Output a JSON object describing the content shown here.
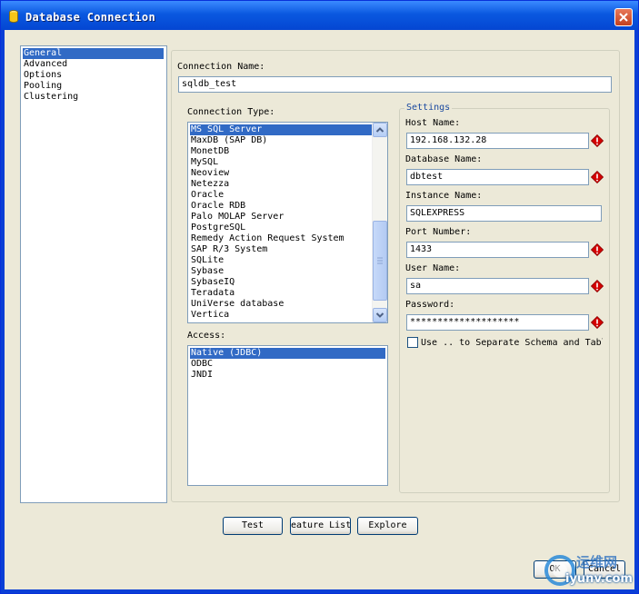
{
  "window": {
    "title": "Database Connection"
  },
  "nav": {
    "items": [
      {
        "label": "General",
        "selected": true
      },
      {
        "label": "Advanced",
        "selected": false
      },
      {
        "label": "Options",
        "selected": false
      },
      {
        "label": "Pooling",
        "selected": false
      },
      {
        "label": "Clustering",
        "selected": false
      }
    ]
  },
  "form": {
    "connection_name_label": "Connection Name:",
    "connection_name_value": "sqldb_test",
    "connection_type_label": "Connection Type:",
    "connection_types": [
      "MS SQL Server",
      "MaxDB (SAP DB)",
      "MonetDB",
      "MySQL",
      "Neoview",
      "Netezza",
      "Oracle",
      "Oracle RDB",
      "Palo MOLAP Server",
      "PostgreSQL",
      "Remedy Action Request System",
      "SAP R/3 System",
      "SQLite",
      "Sybase",
      "SybaseIQ",
      "Teradata",
      "UniVerse database",
      "Vertica"
    ],
    "selected_connection_type": "MS SQL Server",
    "access_label": "Access:",
    "access_options": [
      "Native (JDBC)",
      "ODBC",
      "JNDI"
    ],
    "selected_access": "Native (JDBC)"
  },
  "settings": {
    "title": "Settings",
    "host_name_label": "Host Name:",
    "host_name_value": "192.168.132.28",
    "database_name_label": "Database Name:",
    "database_name_value": "dbtest",
    "instance_name_label": "Instance Name:",
    "instance_name_value": "SQLEXPRESS",
    "port_number_label": "Port Number:",
    "port_number_value": "1433",
    "user_name_label": "User Name:",
    "user_name_value": "sa",
    "password_label": "Password:",
    "password_value": "********************",
    "separate_schema_label": "Use .. to Separate Schema and Tabl",
    "separate_schema_checked": false
  },
  "buttons": {
    "test": "Test",
    "feature_list": "eature List",
    "explore": "Explore",
    "ok": "OK",
    "cancel": "Cancel"
  },
  "watermark": {
    "text": "运维网",
    "url": "iyunv.com"
  },
  "colors": {
    "title_bar": "#0a58e0",
    "selection": "#316ac5",
    "required_marker": "#d40000"
  }
}
